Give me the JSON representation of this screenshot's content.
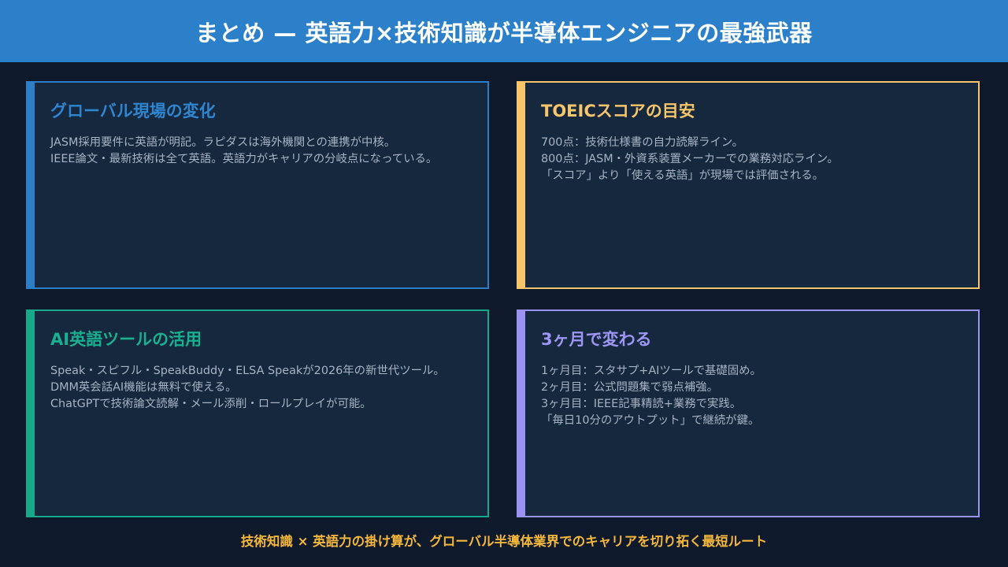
{
  "title": "まとめ — 英語力×技術知識が半導体エンジニアの最強武器",
  "colors": {
    "background": "#0e1a2b",
    "title_bar": "#2b80c9",
    "card_fill": "#15283e",
    "blue": "#2b7fc6",
    "yellow": "#f7c56a",
    "green": "#16a98a",
    "purple": "#9b93f2",
    "footer": "#f5b73b"
  },
  "cards": [
    {
      "title": "グローバル現場の変化",
      "lines": [
        "JASM採用要件に英語が明記。ラピダスは海外機関との連携が中核。",
        "IEEE論文・最新技術は全て英語。英語力がキャリアの分岐点になっている。"
      ]
    },
    {
      "title": "TOEICスコアの目安",
      "lines": [
        "700点：技術仕様書の自力読解ライン。",
        "800点：JASM・外資系装置メーカーでの業務対応ライン。",
        "「スコア」より「使える英語」が現場では評価される。"
      ]
    },
    {
      "title": "AI英語ツールの活用",
      "lines": [
        "Speak・スピフル・SpeakBuddy・ELSA Speakが2026年の新世代ツール。",
        "DMM英会話AI機能は無料で使える。",
        "ChatGPTで技術論文読解・メール添削・ロールプレイが可能。"
      ]
    },
    {
      "title": "3ヶ月で変わる",
      "lines": [
        "1ヶ月目：スタサプ+AIツールで基礎固め。",
        "2ヶ月目：公式問題集で弱点補強。",
        "3ヶ月目：IEEE記事精読+業務で実践。",
        "「毎日10分のアウトプット」で継続が鍵。"
      ]
    }
  ],
  "footer": "技術知識 × 英語力の掛け算が、グローバル半導体業界でのキャリアを切り拓く最短ルート"
}
